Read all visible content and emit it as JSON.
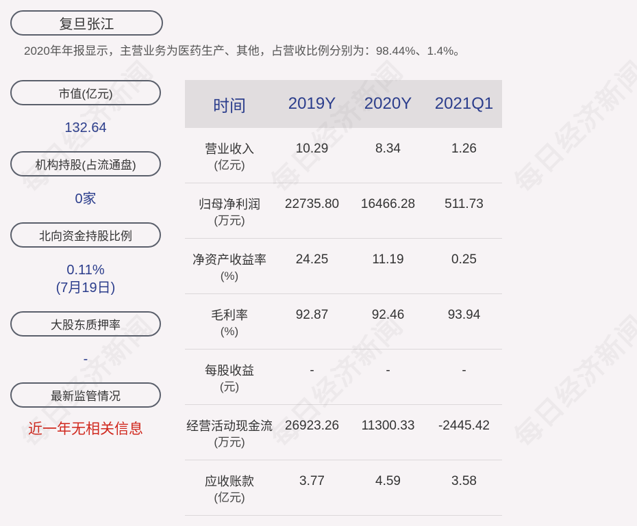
{
  "company": {
    "name": "复旦张江"
  },
  "summary": "2020年年报显示，主营业务为医药生产、其他，占营收比例分别为：98.44%、1.4%。",
  "metrics": [
    {
      "label": "市值(亿元)",
      "value": "132.64"
    },
    {
      "label": "机构持股(占流通盘)",
      "value": "0家"
    },
    {
      "label": "北向资金持股比例",
      "value": "0.11%",
      "note": "(7月19日)"
    },
    {
      "label": "大股东质押率",
      "value": "-"
    },
    {
      "label": "最新监管情况",
      "value": "近一年无相关信息"
    }
  ],
  "table": {
    "headers": [
      "时间",
      "2019Y",
      "2020Y",
      "2021Q1"
    ],
    "rows": [
      {
        "label": "营业收入",
        "unit": "(亿元)",
        "values": [
          "10.29",
          "8.34",
          "1.26"
        ]
      },
      {
        "label": "归母净利润",
        "unit": "(万元)",
        "values": [
          "22735.80",
          "16466.28",
          "511.73"
        ]
      },
      {
        "label": "净资产收益率",
        "unit": "(%)",
        "values": [
          "24.25",
          "11.19",
          "0.25"
        ]
      },
      {
        "label": "毛利率",
        "unit": "(%)",
        "values": [
          "92.87",
          "92.46",
          "93.94"
        ]
      },
      {
        "label": "每股收益",
        "unit": "(元)",
        "values": [
          "-",
          "-",
          "-"
        ]
      },
      {
        "label": "经营活动现金流",
        "unit": "(万元)",
        "values": [
          "26923.26",
          "11300.33",
          "-2445.42"
        ]
      },
      {
        "label": "应收账款",
        "unit": "(亿元)",
        "values": [
          "3.77",
          "4.59",
          "3.58"
        ]
      }
    ]
  },
  "watermark": "每日经济新闻",
  "colors": {
    "background": "#f7f3f5",
    "accent": "#2b3d8c",
    "alert": "#d0281e",
    "header_bg": "#e1dddf"
  }
}
